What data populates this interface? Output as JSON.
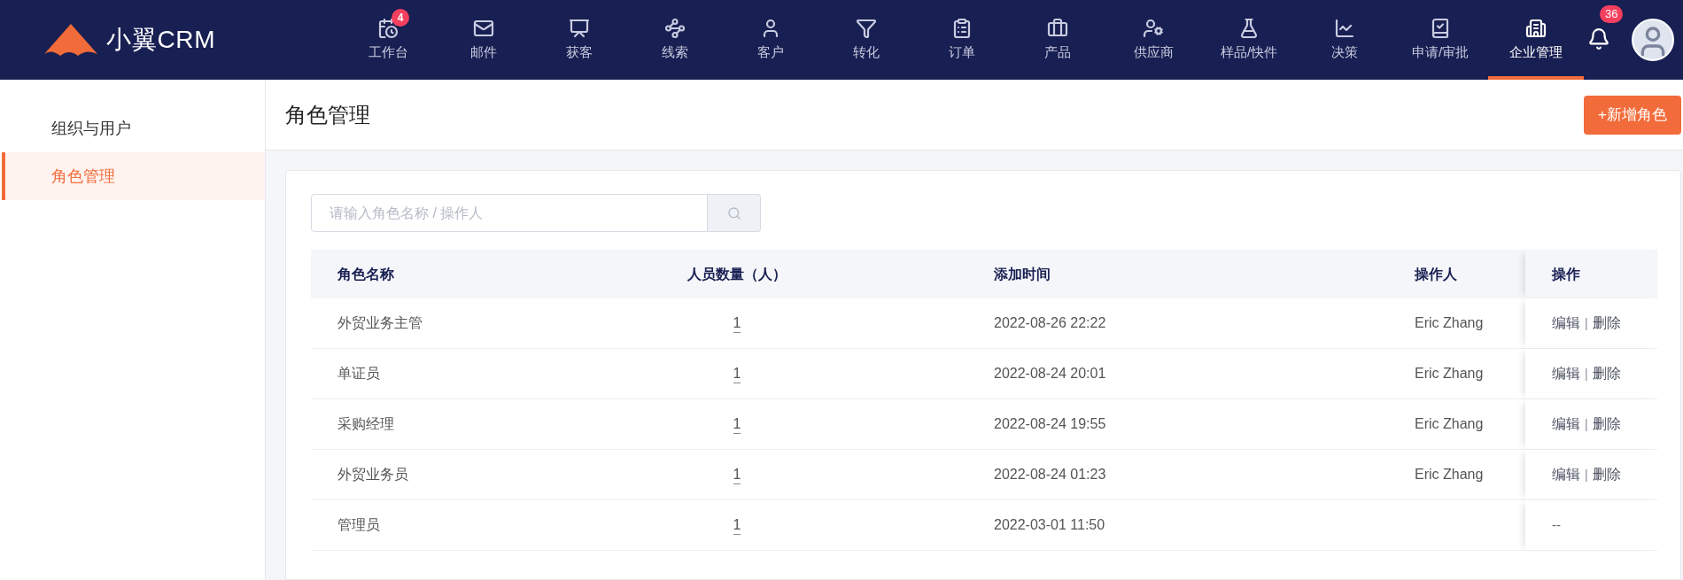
{
  "header": {
    "logo_text": "小翼CRM",
    "nav": [
      {
        "label": "工作台",
        "badge": "4",
        "selected": false
      },
      {
        "label": "邮件",
        "selected": false
      },
      {
        "label": "获客",
        "selected": false
      },
      {
        "label": "线索",
        "selected": false
      },
      {
        "label": "客户",
        "selected": false
      },
      {
        "label": "转化",
        "selected": false
      },
      {
        "label": "订单",
        "selected": false
      },
      {
        "label": "产品",
        "selected": false
      },
      {
        "label": "供应商",
        "selected": false
      },
      {
        "label": "样品/快件",
        "selected": false
      },
      {
        "label": "决策",
        "selected": false
      },
      {
        "label": "申请/审批",
        "selected": false
      },
      {
        "label": "企业管理",
        "selected": true
      }
    ],
    "notifications_badge": "36"
  },
  "sidebar": {
    "items": [
      {
        "label": "组织与用户",
        "selected": false
      },
      {
        "label": "角色管理",
        "selected": true
      }
    ]
  },
  "page": {
    "title": "角色管理",
    "add_button": "+新增角色"
  },
  "search": {
    "placeholder": "请输入角色名称 / 操作人"
  },
  "table": {
    "columns": [
      "角色名称",
      "人员数量（人）",
      "添加时间",
      "操作人",
      "操作"
    ],
    "rows": [
      {
        "name": "外贸业务主管",
        "count": "1",
        "time": "2022-08-26 22:22",
        "operator": "Eric Zhang",
        "actions": [
          {
            "kind": "link",
            "label": "编辑"
          },
          {
            "kind": "separator",
            "label": "|"
          },
          {
            "kind": "link",
            "label": "删除"
          }
        ]
      },
      {
        "name": "单证员",
        "count": "1",
        "time": "2022-08-24 20:01",
        "operator": "Eric Zhang",
        "actions": [
          {
            "kind": "link",
            "label": "编辑"
          },
          {
            "kind": "separator",
            "label": "|"
          },
          {
            "kind": "link",
            "label": "删除"
          }
        ]
      },
      {
        "name": "采购经理",
        "count": "1",
        "time": "2022-08-24 19:55",
        "operator": "Eric Zhang",
        "actions": [
          {
            "kind": "link",
            "label": "编辑"
          },
          {
            "kind": "separator",
            "label": "|"
          },
          {
            "kind": "link",
            "label": "删除"
          }
        ]
      },
      {
        "name": "外贸业务员",
        "count": "1",
        "time": "2022-08-24 01:23",
        "operator": "Eric Zhang",
        "actions": [
          {
            "kind": "link",
            "label": "编辑"
          },
          {
            "kind": "separator",
            "label": "|"
          },
          {
            "kind": "link",
            "label": "删除"
          }
        ]
      },
      {
        "name": "管理员",
        "count": "1",
        "time": "2022-03-01 11:50",
        "actions": [
          {
            "kind": "text",
            "label": "--"
          }
        ]
      }
    ]
  }
}
